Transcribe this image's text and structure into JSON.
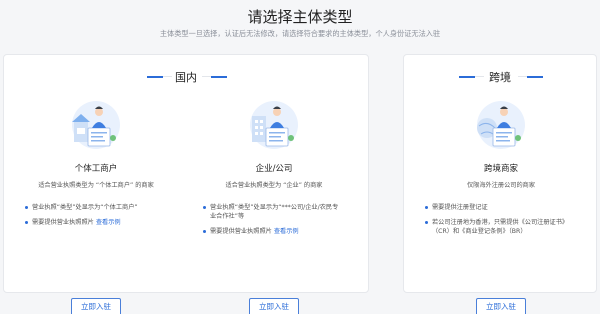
{
  "header": {
    "title": "请选择主体类型",
    "subtitle": "主体类型一旦选择，认证后无法修改，请选择符合要求的主体类型，个人身份证无法入驻"
  },
  "colors": {
    "accent": "#2b6cd8",
    "panel_bg": "#ffffff",
    "page_bg": "#f5f6f8"
  },
  "domestic": {
    "label": "国内",
    "cards": [
      {
        "title": "个体工商户",
        "desc": "适合营业执照类型为 “个体工商户” 的商家",
        "icon": "individual-business-icon",
        "requirements": [
          {
            "text": "营业执照“类型”处显示为“个体工商户”",
            "link": ""
          },
          {
            "text": "需要提供营业执照照片",
            "link": "查看示例"
          }
        ],
        "button": "立即入驻"
      },
      {
        "title": "企业/公司",
        "desc": "适合营业执照类型为 “企业” 的商家",
        "icon": "enterprise-icon",
        "requirements": [
          {
            "text": "营业执照“类型”处显示为“***公司/企业/农民专业合作社”等",
            "link": ""
          },
          {
            "text": "需要提供营业执照照片",
            "link": "查看示例"
          }
        ],
        "button": "立即入驻"
      }
    ]
  },
  "cross_border": {
    "label": "跨境",
    "card": {
      "title": "跨境商家",
      "desc": "仅限海外注册公司的商家",
      "icon": "cross-border-icon",
      "requirements": [
        {
          "text": "需要提供注册登记证",
          "link": ""
        },
        {
          "text": "若公司注册地为香港，只需提供《公司注册证书》（CR）和《商业登记条例》（BR）",
          "link": ""
        }
      ],
      "button": "立即入驻"
    }
  }
}
